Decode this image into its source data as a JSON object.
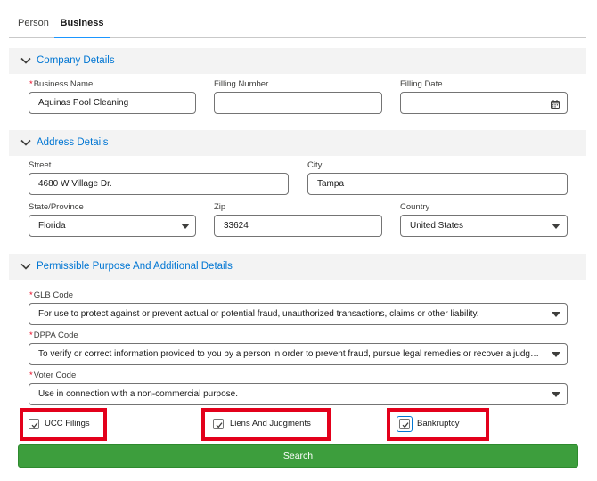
{
  "tabs": [
    {
      "label": "Person"
    },
    {
      "label": "Business"
    }
  ],
  "sections": {
    "company": "Company Details",
    "address": "Address Details",
    "purpose": "Permissible Purpose And Additional Details"
  },
  "company": {
    "business_name_label": "Business Name",
    "business_name_value": "Aquinas Pool Cleaning",
    "filling_number_label": "Filling Number",
    "filling_number_value": "",
    "filling_date_label": "Filling Date",
    "filling_date_value": ""
  },
  "address": {
    "street_label": "Street",
    "street_value": "4680 W Village Dr.",
    "city_label": "City",
    "city_value": "Tampa",
    "state_label": "State/Province",
    "state_value": "Florida",
    "zip_label": "Zip",
    "zip_value": "33624",
    "country_label": "Country",
    "country_value": "United States"
  },
  "purpose": {
    "glb_label": "GLB Code",
    "glb_value": "For use to protect against or prevent actual or potential fraud, unauthorized transactions, claims or other liability.",
    "dppa_label": "DPPA Code",
    "dppa_value": "To verify or correct information provided to you by a person in order to prevent fraud, pursue legal remedies or recover a judgment",
    "voter_label": "Voter Code",
    "voter_value": "Use in connection with a non-commercial purpose."
  },
  "checkboxes": [
    {
      "label": "UCC Filings",
      "checked": true
    },
    {
      "label": "Liens And Judgments",
      "checked": true
    },
    {
      "label": "Bankruptcy",
      "checked": true
    }
  ],
  "search_label": "Search",
  "colors": {
    "accent": "#0176d3",
    "highlight": "#e3001b",
    "search_button": "#3d9e3d",
    "required": "#ea001e"
  }
}
